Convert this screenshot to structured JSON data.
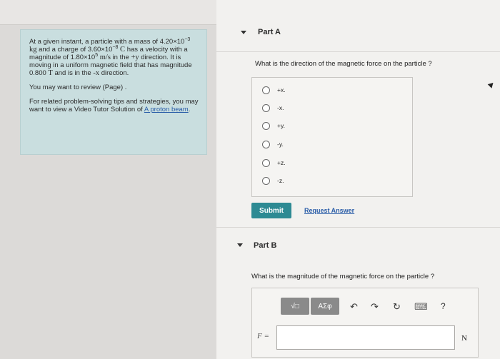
{
  "problem": {
    "p1_a": "At a given instant, a particle with a mass of",
    "mass_coef": "4.20×10",
    "mass_exp": "−3",
    "mass_unit": "kg",
    "p1_b": "and a charge of",
    "charge_coef": "3.60×10",
    "charge_exp": "−8",
    "charge_unit": "C",
    "p1_c": "has a velocity with a magnitude of",
    "vel_coef": "1.80×10",
    "vel_exp": "5",
    "vel_unit": "m/s",
    "p1_d": "in the",
    "dir_y": "+y",
    "p1_e": "direction. It is moving in a uniform magnetic field that has magnitude",
    "field_val": "0.800",
    "field_unit": "T",
    "p1_f": "and is in the",
    "dir_x": "-x",
    "p1_g": "direction.",
    "review_text": "You may want to review (Page) .",
    "tips_text": "For related problem-solving tips and strategies, you may want to view a Video Tutor Solution of",
    "tips_link": "A proton beam",
    "tips_end": "."
  },
  "partA": {
    "title": "Part A",
    "question": "What is the direction of the magnetic force on the particle ?",
    "options": [
      "+x.",
      "-x.",
      "+y.",
      "-y.",
      "+z.",
      "-z."
    ],
    "submit_label": "Submit",
    "request_label": "Request Answer"
  },
  "partB": {
    "title": "Part B",
    "question": "What is the magnitude of the magnetic force on the particle ?",
    "toolbar": {
      "templates_label": "√□",
      "symbols_label": "ΑΣφ",
      "undo_icon": "↶",
      "redo_icon": "↷",
      "reset_icon": "↻",
      "keyboard_icon": "⌨",
      "help_label": "?"
    },
    "variable": "F =",
    "input_value": "",
    "unit": "N"
  },
  "colors": {
    "accent": "#2d8a93",
    "link": "#2a5da8",
    "problem_bg": "#c9dedf"
  }
}
